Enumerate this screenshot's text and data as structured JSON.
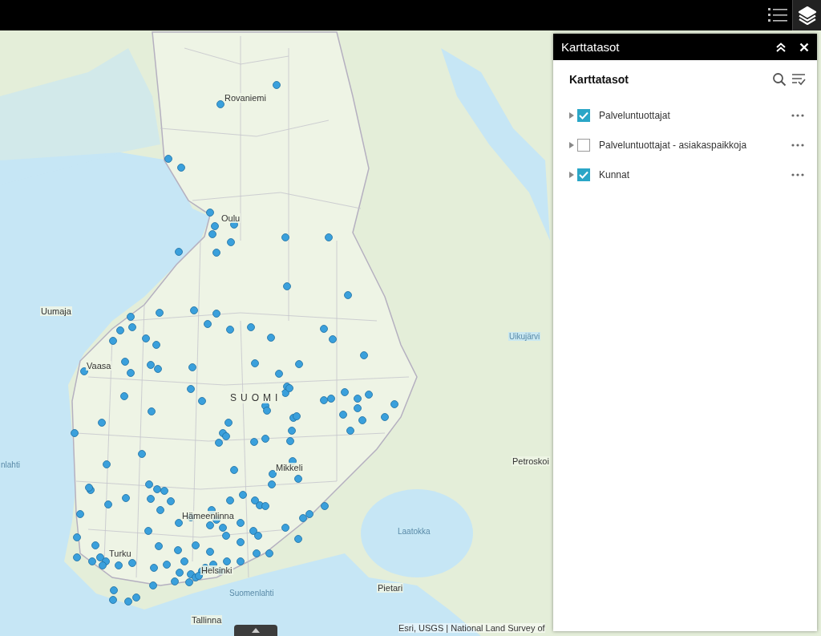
{
  "top_bar": {
    "tools": [
      {
        "kind": "legend",
        "selected": false
      },
      {
        "kind": "layers",
        "selected": true
      }
    ]
  },
  "map": {
    "labels": [
      {
        "text": "Rovaniemi",
        "kind": "city"
      },
      {
        "text": "Oulu",
        "kind": "city"
      },
      {
        "text": "Uumaja",
        "kind": "city"
      },
      {
        "text": "Vaasa",
        "kind": "city"
      },
      {
        "text": "SUOMI",
        "kind": "country"
      },
      {
        "text": "Mikkeli",
        "kind": "city"
      },
      {
        "text": "Hämeenlinna",
        "kind": "city"
      },
      {
        "text": "Turku",
        "kind": "city"
      },
      {
        "text": "Helsinki",
        "kind": "city"
      },
      {
        "text": "Suomenlahti",
        "kind": "water"
      },
      {
        "text": "Tallinna",
        "kind": "city"
      },
      {
        "text": "Pietari",
        "kind": "city"
      },
      {
        "text": "Laatokka",
        "kind": "water"
      },
      {
        "text": "Petroskoi",
        "kind": "city"
      },
      {
        "text": "Uikujärvi",
        "kind": "water"
      },
      {
        "text": "nlahti",
        "kind": "water"
      }
    ],
    "attribution": "Esri, USGS | National Land Survey of"
  },
  "panel": {
    "title": "Karttatasot",
    "heading": "Karttatasot",
    "layers": [
      {
        "name": "Palveluntuottajat",
        "checked": true,
        "expanded": false
      },
      {
        "name": "Palveluntuottajat - asiakaspaikkoja",
        "checked": false,
        "expanded": false
      },
      {
        "name": "Kunnat",
        "checked": true,
        "expanded": false
      }
    ]
  }
}
